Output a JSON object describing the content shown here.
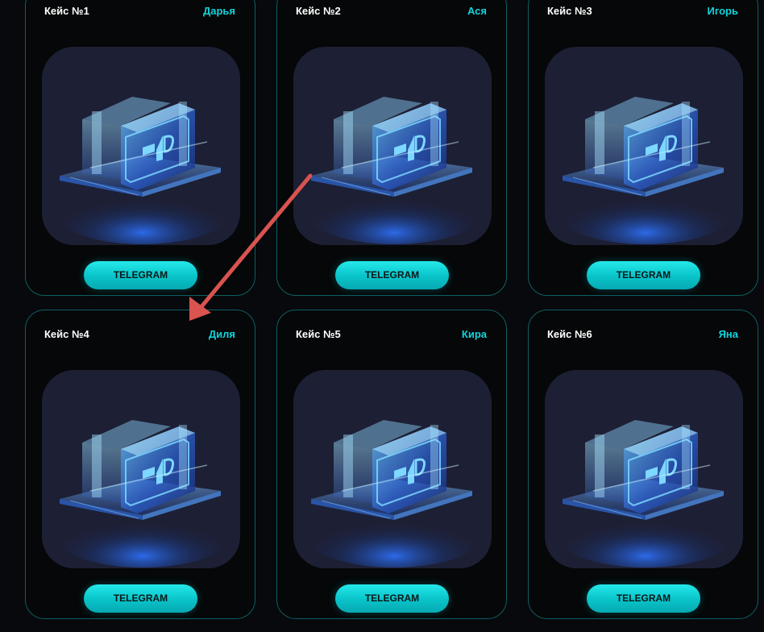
{
  "cards": [
    {
      "title": "Кейс №1",
      "owner": "Дарья",
      "button_label": "TELEGRAM",
      "image": "crypto-hardware-wallet-icon"
    },
    {
      "title": "Кейс №2",
      "owner": "Ася",
      "button_label": "TELEGRAM",
      "image": "crypto-hardware-wallet-icon"
    },
    {
      "title": "Кейс №3",
      "owner": "Игорь",
      "button_label": "TELEGRAM",
      "image": "crypto-hardware-wallet-icon"
    },
    {
      "title": "Кейс №4",
      "owner": "Диля",
      "button_label": "TELEGRAM",
      "image": "crypto-hardware-wallet-icon"
    },
    {
      "title": "Кейс №5",
      "owner": "Кира",
      "button_label": "TELEGRAM",
      "image": "crypto-hardware-wallet-icon"
    },
    {
      "title": "Кейс №6",
      "owner": "Яна",
      "button_label": "TELEGRAM",
      "image": "crypto-hardware-wallet-icon"
    }
  ],
  "colors": {
    "background": "#07090c",
    "card_border": "#0f5f63",
    "accent": "#10d4dd",
    "button_text": "#0a1718",
    "arrow": "#d9534f",
    "image_bg": "#1d1f34"
  },
  "annotation": {
    "type": "arrow",
    "points_to": "Кейс №4"
  }
}
